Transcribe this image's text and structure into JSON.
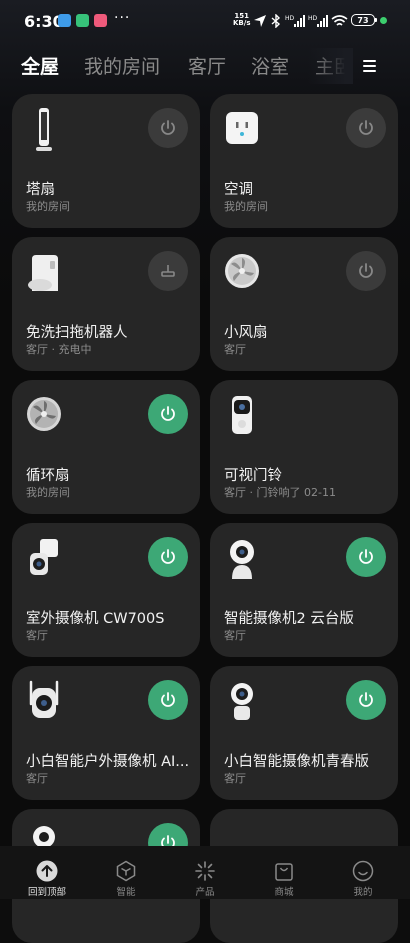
{
  "status_bar": {
    "time": "6:30",
    "more": "···",
    "net_speed_value": "151",
    "net_speed_unit": "KB/s",
    "battery": "73"
  },
  "tabs": [
    {
      "label": "全屋"
    },
    {
      "label": "我的房间"
    },
    {
      "label": "客厅"
    },
    {
      "label": "浴室"
    },
    {
      "label": "主卧"
    }
  ],
  "devices": [
    {
      "name": "塔扇",
      "sub": "我的房间",
      "icon": "tower-fan-icon",
      "power_on": false
    },
    {
      "name": "空调",
      "sub": "我的房间",
      "icon": "ac-companion-icon",
      "power_on": false
    },
    {
      "name": "免洗扫拖机器人",
      "sub": "客厅 · 充电中",
      "icon": "robot-vacuum-icon",
      "power_on": false
    },
    {
      "name": "小风扇",
      "sub": "客厅",
      "icon": "desk-fan-icon",
      "power_on": false
    },
    {
      "name": "循环扇",
      "sub": "我的房间",
      "icon": "circulator-fan-icon",
      "power_on": true
    },
    {
      "name": "可视门铃",
      "sub": "客厅 · 门铃响了 02-11",
      "icon": "doorbell-icon",
      "power_on": null
    },
    {
      "name": "室外摄像机 CW700S",
      "sub": "客厅",
      "icon": "outdoor-camera-icon",
      "power_on": true
    },
    {
      "name": "智能摄像机2 云台版",
      "sub": "客厅",
      "icon": "ptz-camera-icon",
      "power_on": true
    },
    {
      "name": "小白智能户外摄像机 AI...",
      "sub": "客厅",
      "icon": "outdoor-ai-camera-icon",
      "power_on": true
    },
    {
      "name": "小白智能摄像机青春版",
      "sub": "客厅",
      "icon": "youth-camera-icon",
      "power_on": true
    }
  ],
  "bottom_nav": [
    {
      "label": "回到顶部",
      "icon": "arrow-up-icon",
      "active": true
    },
    {
      "label": "智能",
      "icon": "smart-cube-icon",
      "active": false
    },
    {
      "label": "产品",
      "icon": "product-spark-icon",
      "active": false
    },
    {
      "label": "商城",
      "icon": "shopping-bag-icon",
      "active": false
    },
    {
      "label": "我的",
      "icon": "profile-smile-icon",
      "active": false
    }
  ],
  "colors": {
    "accent_power_on": "#3da876",
    "card_bg": "#262626",
    "page_bg": "#0b0b0b"
  }
}
